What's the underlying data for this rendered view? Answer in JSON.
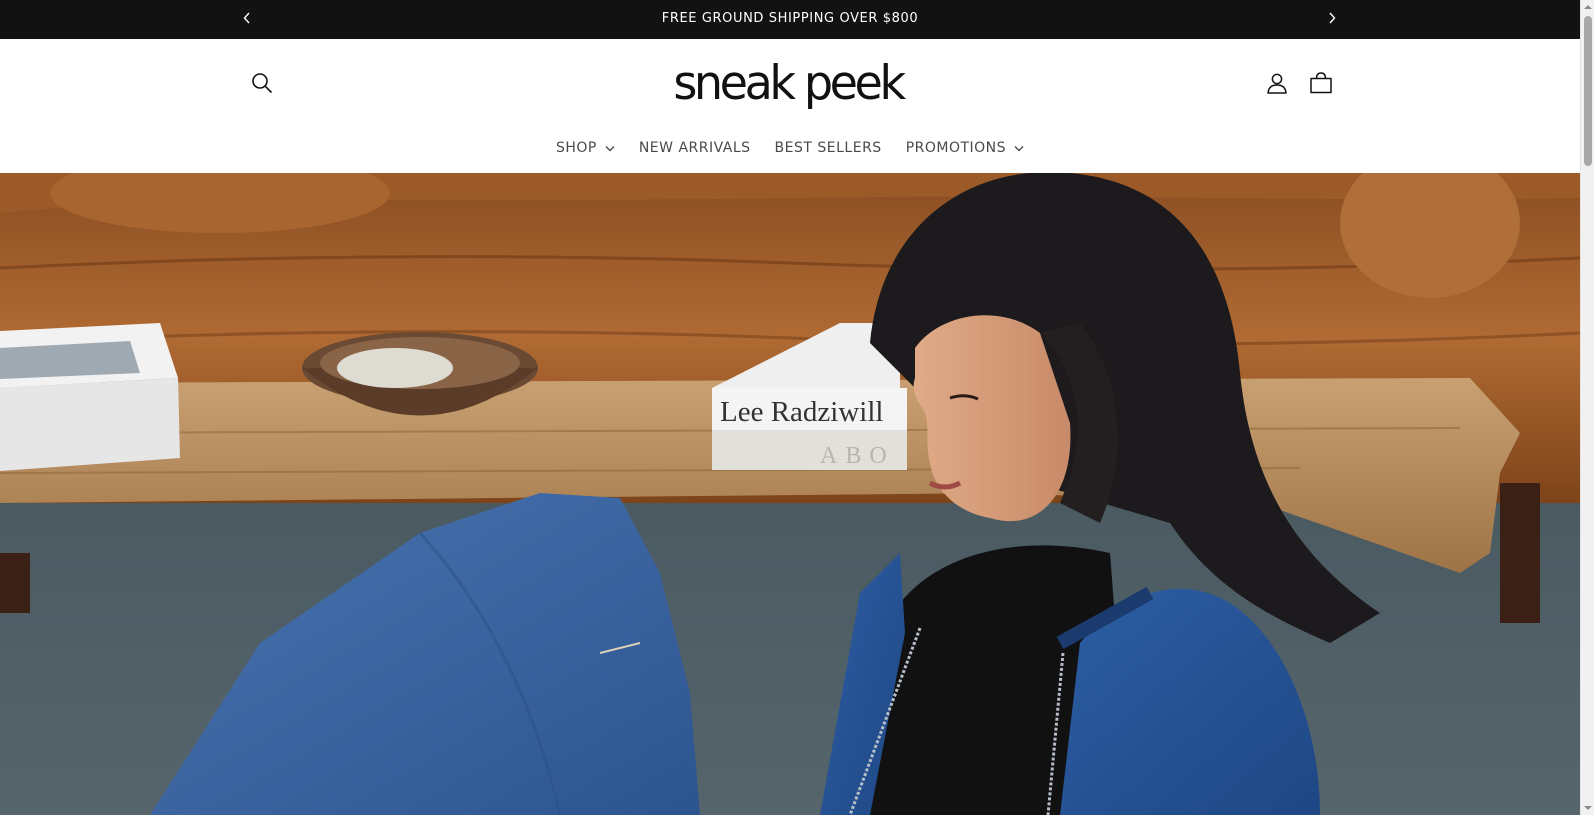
{
  "announcement": {
    "text": "FREE GROUND SHIPPING OVER $800",
    "prev_icon": "chevron-left-icon",
    "next_icon": "chevron-right-icon",
    "background": "#121212",
    "text_color": "#ffffff"
  },
  "header": {
    "logo_text": "sneak peek",
    "icons": {
      "search": "search-icon",
      "account": "account-icon",
      "cart": "cart-icon"
    }
  },
  "nav": {
    "items": [
      {
        "label": "SHOP",
        "has_dropdown": true
      },
      {
        "label": "NEW ARRIVALS",
        "has_dropdown": false
      },
      {
        "label": "BEST SELLERS",
        "has_dropdown": false
      },
      {
        "label": "PROMOTIONS",
        "has_dropdown": true
      }
    ]
  },
  "hero": {
    "book_title": "Lee Radziwill",
    "book_subtitle": "ABO"
  }
}
